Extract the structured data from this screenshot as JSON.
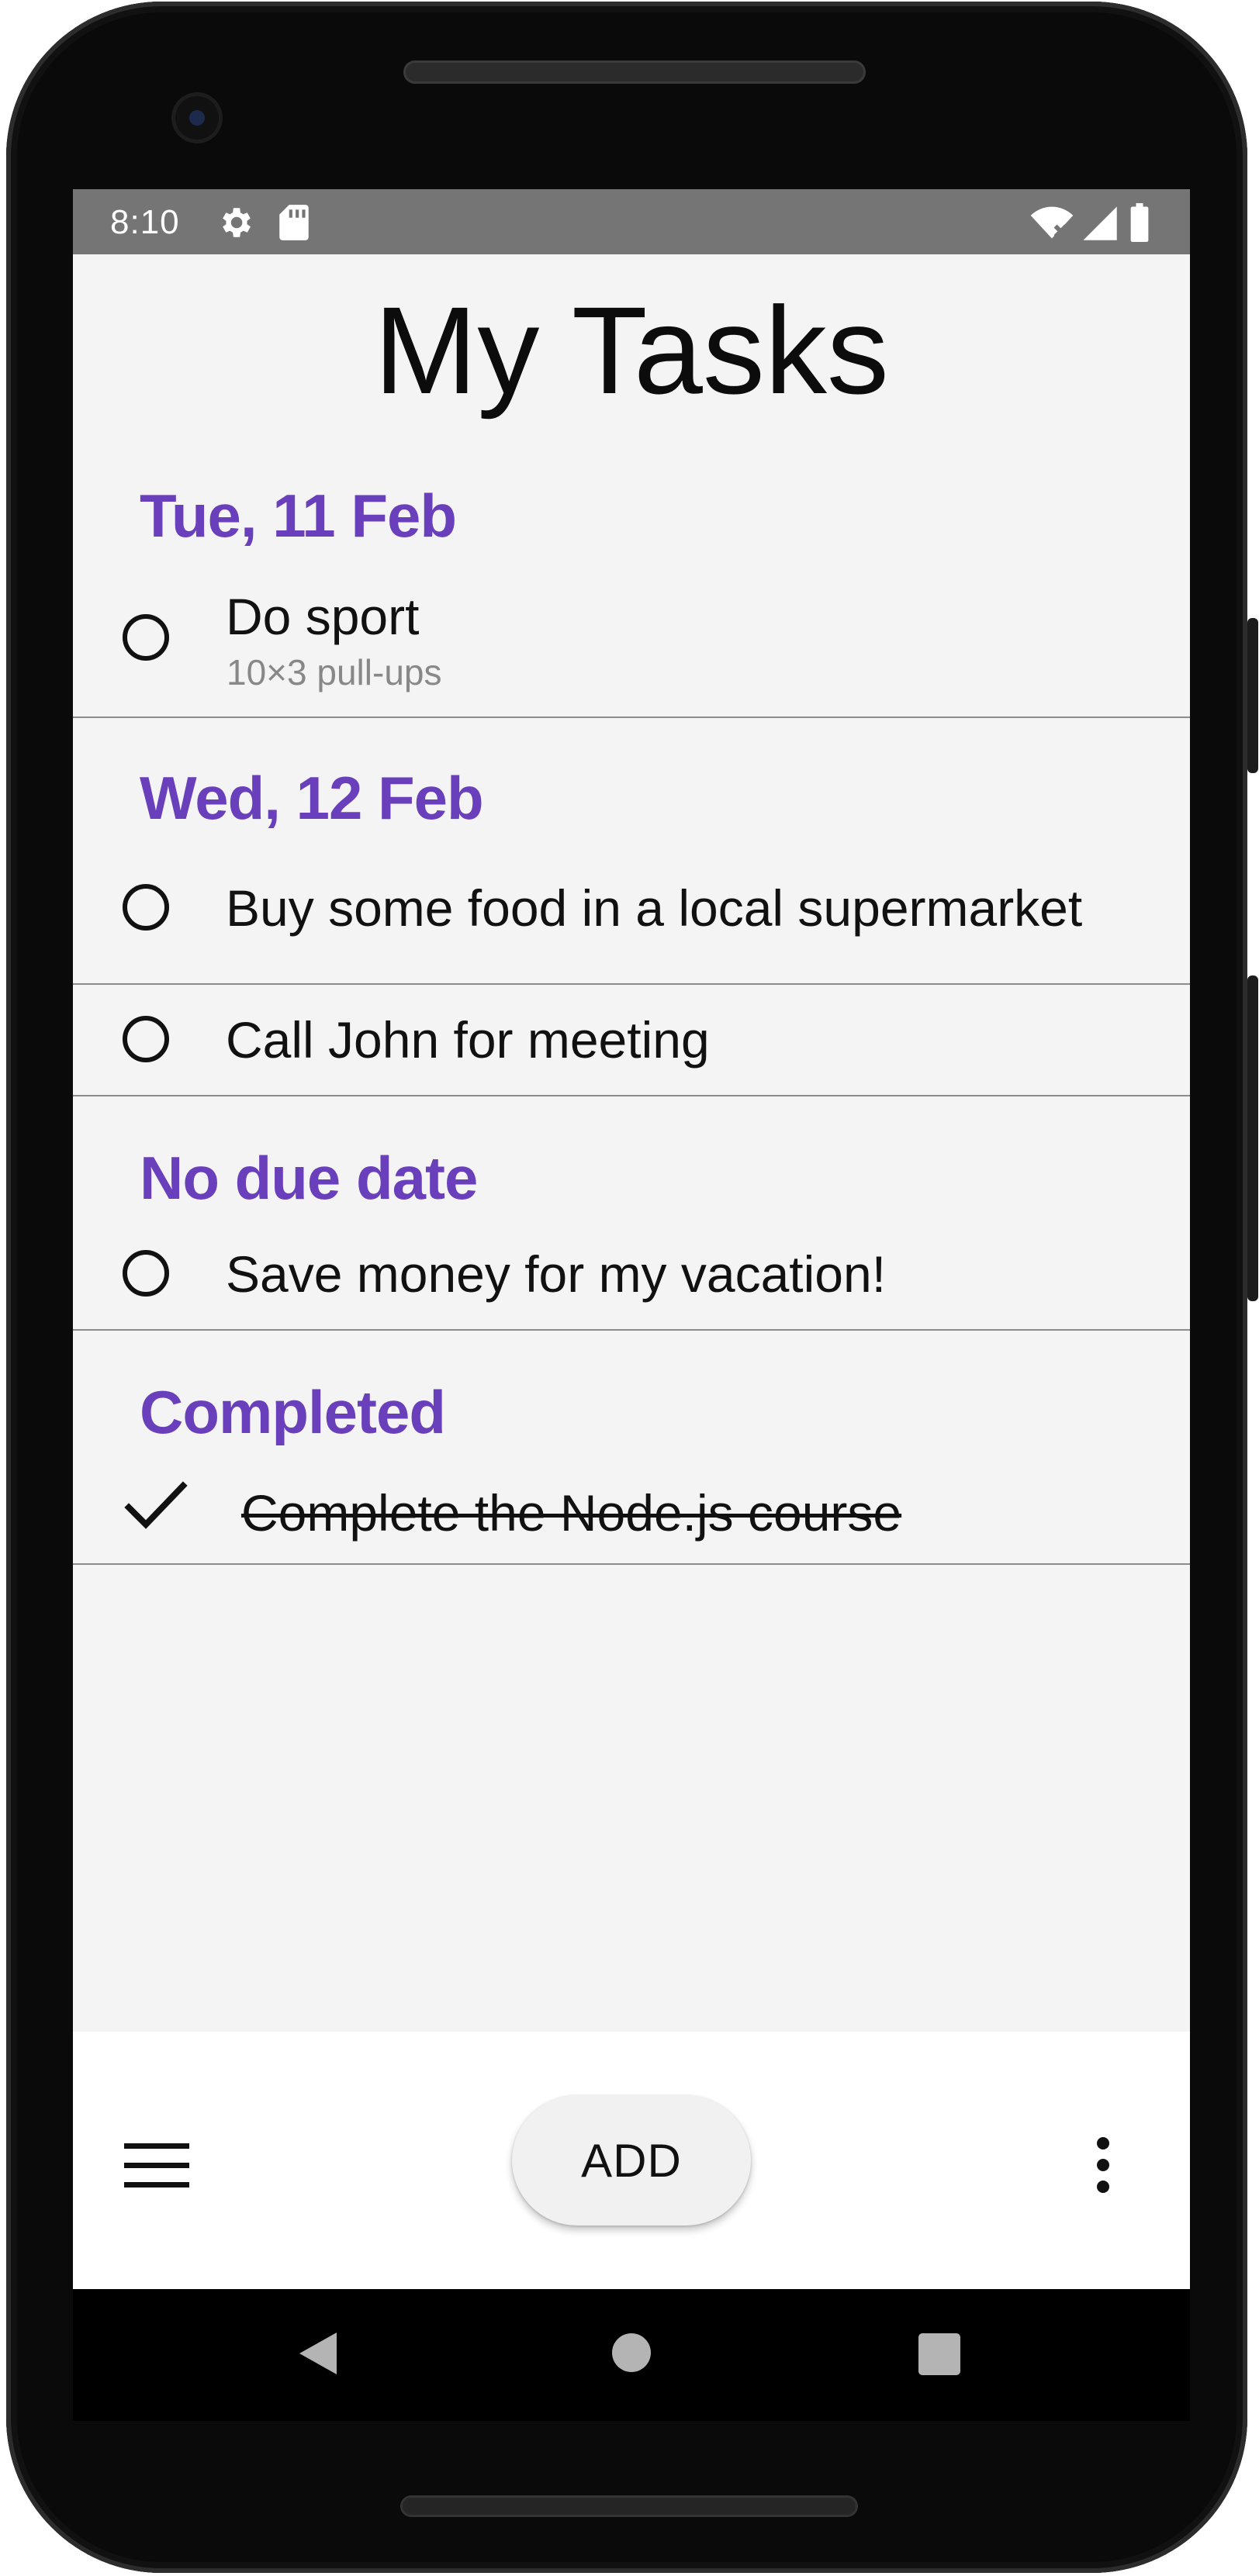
{
  "status_bar": {
    "time": "8:10",
    "left_icons": [
      "gear-icon",
      "sd-card-icon"
    ],
    "right_icons": [
      "wifi-icon",
      "signal-icon",
      "battery-icon"
    ]
  },
  "app": {
    "title": "My Tasks"
  },
  "sections": [
    {
      "header": "Tue, 11 Feb",
      "tasks": [
        {
          "title": "Do sport",
          "subtitle": "10×3 pull-ups",
          "completed": false
        }
      ]
    },
    {
      "header": "Wed, 12 Feb",
      "tasks": [
        {
          "title": "Buy some food in a local supermarket",
          "completed": false
        },
        {
          "title": "Call John for meeting",
          "completed": false
        }
      ]
    },
    {
      "header": "No due date",
      "tasks": [
        {
          "title": "Save money for my vacation!",
          "completed": false
        }
      ]
    },
    {
      "header": "Completed",
      "tasks": [
        {
          "title": "Complete the Node.js course",
          "completed": true
        }
      ]
    }
  ],
  "bottom_bar": {
    "add_label": "ADD",
    "left_icon": "menu-icon",
    "right_icon": "more-vert-icon"
  },
  "nav_bar": {
    "icons": [
      "back-icon",
      "home-icon",
      "recents-icon"
    ]
  },
  "colors": {
    "accent": "#6a3fbb",
    "status_bar": "#757575",
    "background": "#f4f4f4"
  }
}
